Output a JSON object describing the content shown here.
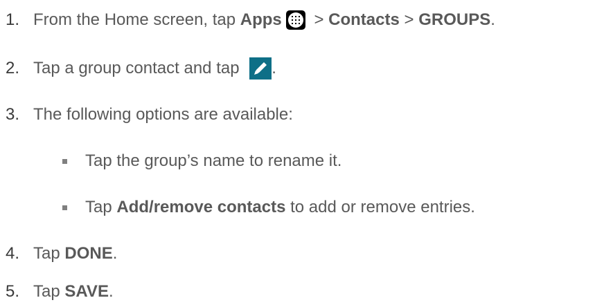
{
  "steps": [
    {
      "number": "1.",
      "prefix": "From the Home screen, tap ",
      "apps": "Apps",
      "sep1": " > ",
      "contacts": "Contacts",
      "sep2": " > ",
      "groups": "GROUPS",
      "suffix": ".",
      "icon": "apps-icon"
    },
    {
      "number": "2.",
      "text": "Tap a group contact and tap ",
      "suffix": ".",
      "icon": "edit-pencil-icon"
    },
    {
      "number": "3.",
      "text": "The following options are available:"
    },
    {
      "number": "4.",
      "prefix": "Tap ",
      "bold": "DONE",
      "suffix": "."
    },
    {
      "number": "5.",
      "prefix": "Tap ",
      "bold": "SAVE",
      "suffix": "."
    }
  ],
  "sub_items": [
    {
      "text": "Tap the group’s name to rename it."
    },
    {
      "prefix": "Tap ",
      "bold": "Add/remove contacts",
      "suffix": " to add or remove entries."
    }
  ],
  "colors": {
    "text": "#595959",
    "edit_icon_bg": "#0e6f87",
    "bullet": "#808080"
  }
}
